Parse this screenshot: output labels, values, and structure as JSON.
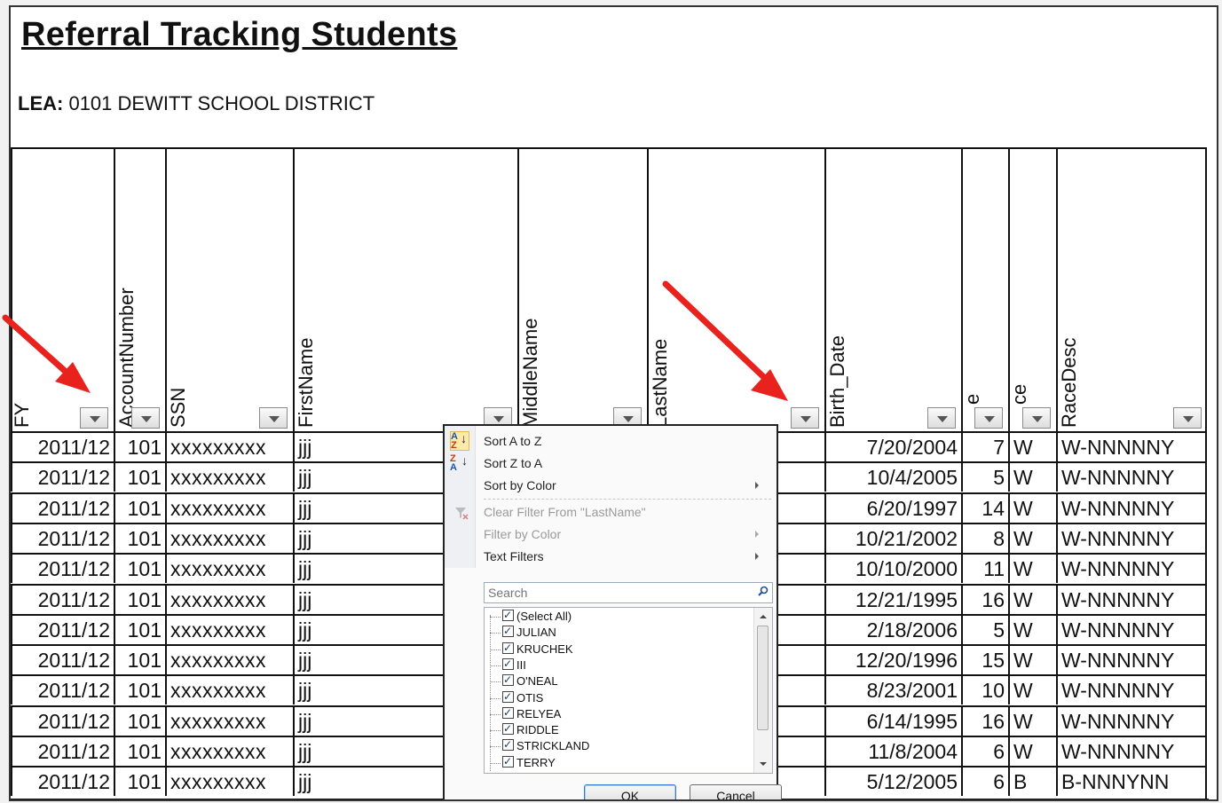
{
  "title": "Referral Tracking Students",
  "lea": {
    "label": "LEA:",
    "value": "0101 DEWITT SCHOOL DISTRICT"
  },
  "columns": [
    {
      "label": "FY",
      "filter": true
    },
    {
      "label": "AccountNumber",
      "filter": true
    },
    {
      "label": "SSN",
      "filter": true
    },
    {
      "label": "FirstName",
      "filter": true
    },
    {
      "label": "MiddleName",
      "filter": true
    },
    {
      "label": "LastName",
      "filter": true
    },
    {
      "label": "Birth_Date",
      "filter": true
    },
    {
      "label": "e",
      "filter": true
    },
    {
      "label": "ce",
      "filter": true
    },
    {
      "label": "RaceDesc",
      "filter": true
    }
  ],
  "rows": [
    {
      "fy": "2011/12",
      "acct": "101",
      "ssn": "xxxxxxxxx",
      "first": "jjj",
      "birth": "7/20/2004",
      "age": "7",
      "race": "W",
      "racedesc": "W-NNNNNY"
    },
    {
      "fy": "2011/12",
      "acct": "101",
      "ssn": "xxxxxxxxx",
      "first": "jjj",
      "birth": "10/4/2005",
      "age": "5",
      "race": "W",
      "racedesc": "W-NNNNNY"
    },
    {
      "fy": "2011/12",
      "acct": "101",
      "ssn": "xxxxxxxxx",
      "first": "jjj",
      "birth": "6/20/1997",
      "age": "14",
      "race": "W",
      "racedesc": "W-NNNNNY"
    },
    {
      "fy": "2011/12",
      "acct": "101",
      "ssn": "xxxxxxxxx",
      "first": "jjj",
      "birth": "10/21/2002",
      "age": "8",
      "race": "W",
      "racedesc": "W-NNNNNY"
    },
    {
      "fy": "2011/12",
      "acct": "101",
      "ssn": "xxxxxxxxx",
      "first": "jjj",
      "birth": "10/10/2000",
      "age": "11",
      "race": "W",
      "racedesc": "W-NNNNNY"
    },
    {
      "fy": "2011/12",
      "acct": "101",
      "ssn": "xxxxxxxxx",
      "first": "jjj",
      "birth": "12/21/1995",
      "age": "16",
      "race": "W",
      "racedesc": "W-NNNNNY"
    },
    {
      "fy": "2011/12",
      "acct": "101",
      "ssn": "xxxxxxxxx",
      "first": "jjj",
      "birth": "2/18/2006",
      "age": "5",
      "race": "W",
      "racedesc": "W-NNNNNY"
    },
    {
      "fy": "2011/12",
      "acct": "101",
      "ssn": "xxxxxxxxx",
      "first": "jjj",
      "birth": "12/20/1996",
      "age": "15",
      "race": "W",
      "racedesc": "W-NNNNNY"
    },
    {
      "fy": "2011/12",
      "acct": "101",
      "ssn": "xxxxxxxxx",
      "first": "jjj",
      "birth": "8/23/2001",
      "age": "10",
      "race": "W",
      "racedesc": "W-NNNNNY"
    },
    {
      "fy": "2011/12",
      "acct": "101",
      "ssn": "xxxxxxxxx",
      "first": "jjj",
      "birth": "6/14/1995",
      "age": "16",
      "race": "W",
      "racedesc": "W-NNNNNY"
    },
    {
      "fy": "2011/12",
      "acct": "101",
      "ssn": "xxxxxxxxx",
      "first": "jjj",
      "birth": "11/8/2004",
      "age": "6",
      "race": "W",
      "racedesc": "W-NNNNNY"
    },
    {
      "fy": "2011/12",
      "acct": "101",
      "ssn": "xxxxxxxxx",
      "first": "jjj",
      "birth": "5/12/2005",
      "age": "6",
      "race": "B",
      "racedesc": "B-NNNYNN"
    }
  ],
  "filter_menu": {
    "sort_az": "Sort A to Z",
    "sort_za": "Sort Z to A",
    "sort_by_color": "Sort by Color",
    "clear_filter": "Clear Filter From \"LastName\"",
    "filter_by_color": "Filter by Color",
    "text_filters": "Text Filters",
    "search_placeholder": "Search",
    "items": [
      "(Select All)",
      "JULIAN",
      "KRUCHEK",
      "III",
      "O'NEAL",
      "OTIS",
      "RELYEA",
      "RIDDLE",
      "STRICKLAND",
      "TERRY"
    ],
    "ok_label": "OK",
    "cancel_label": "Cancel"
  },
  "annotation_color": "#e8231e"
}
